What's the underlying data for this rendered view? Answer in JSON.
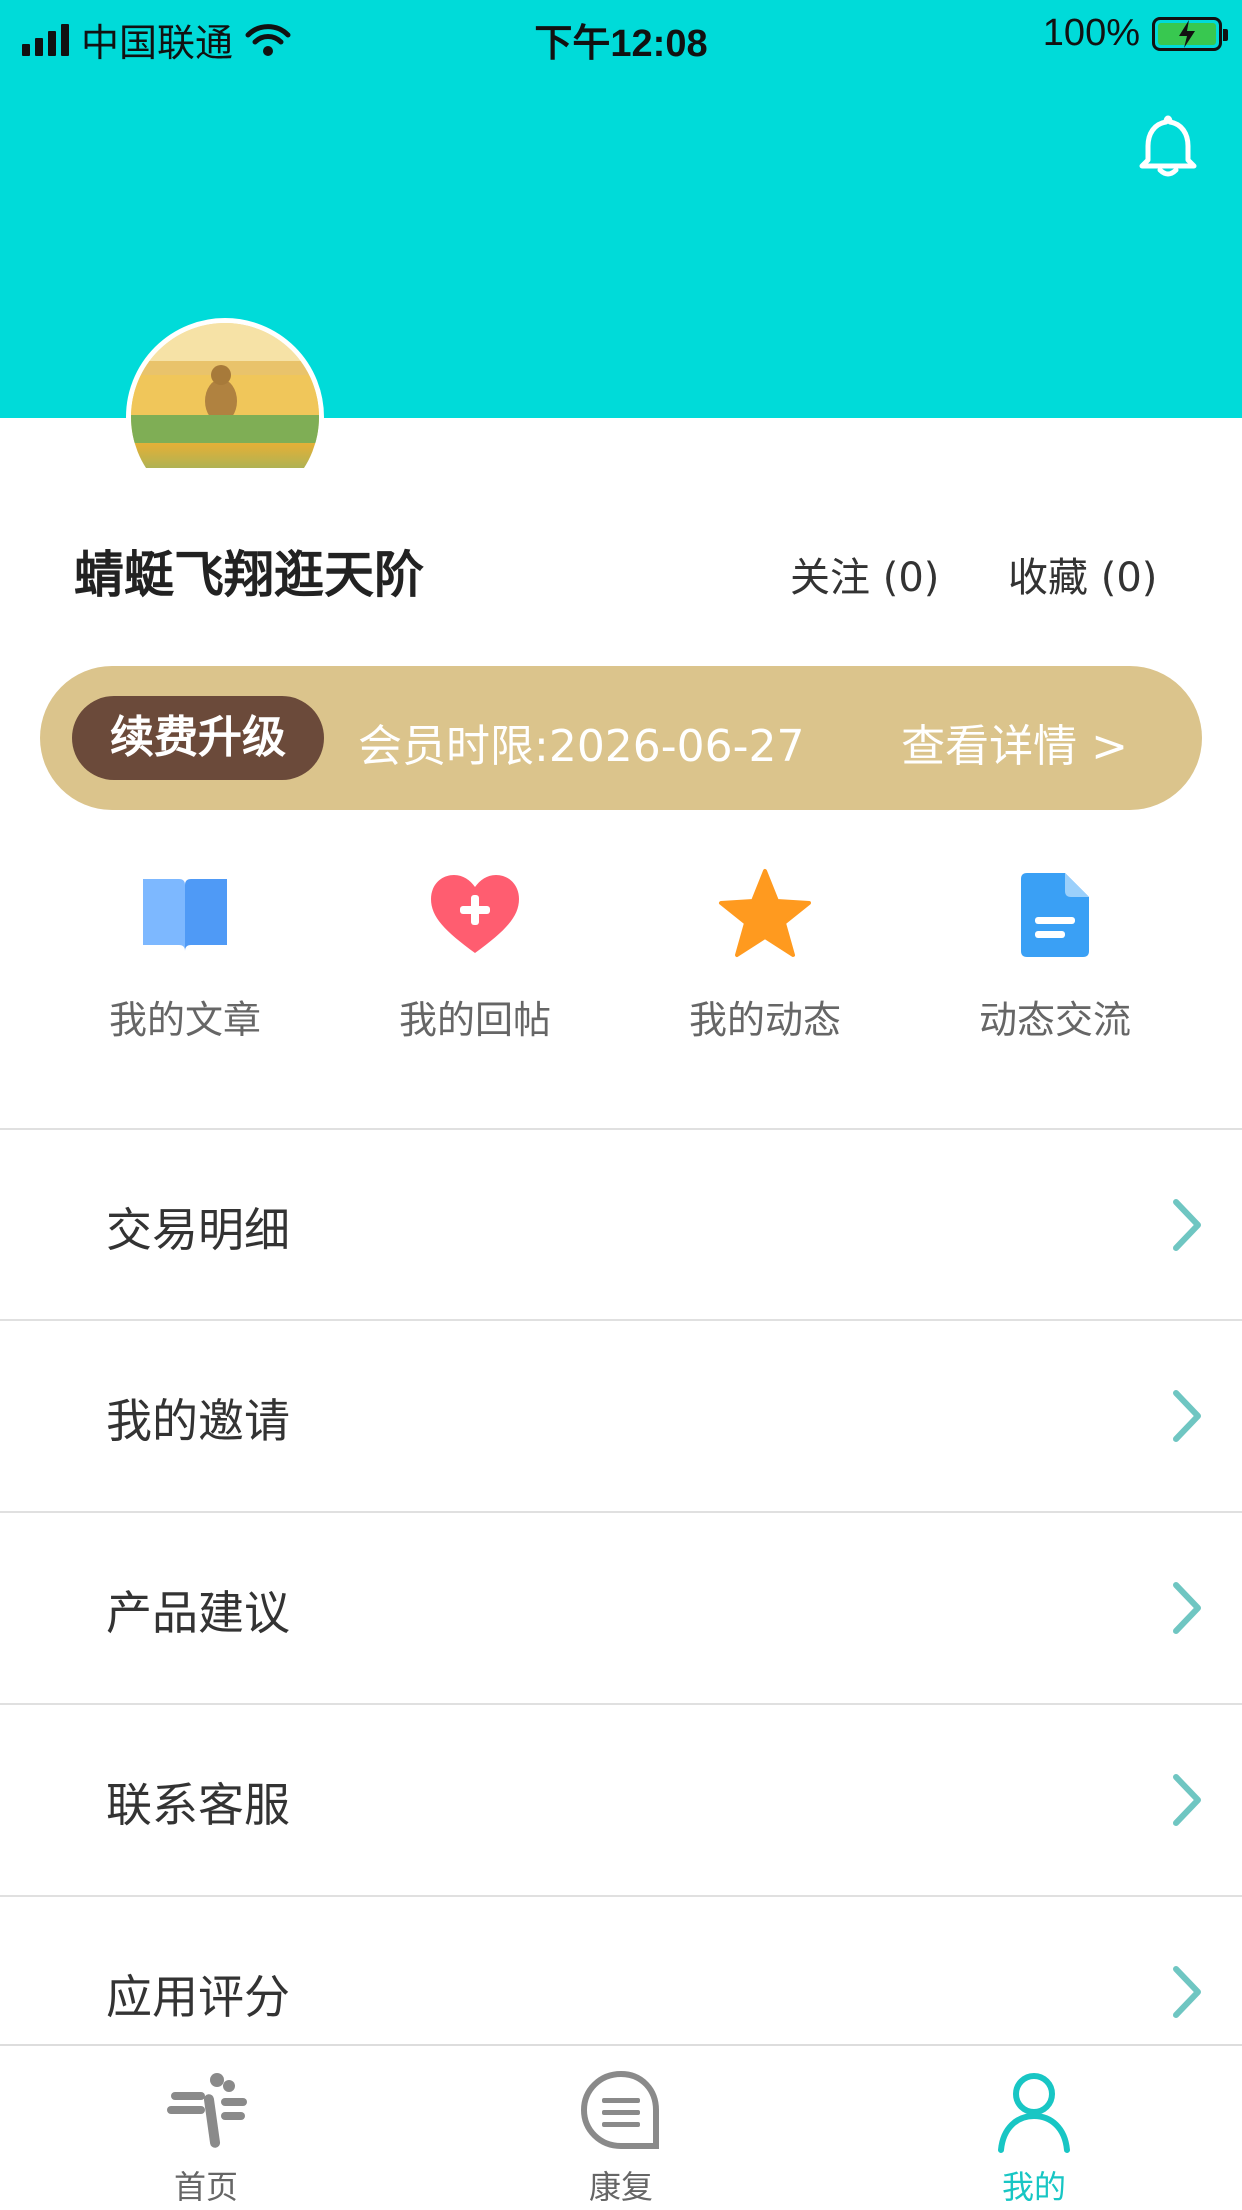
{
  "status_bar": {
    "carrier": "中国联通",
    "time": "下午12:08",
    "battery": "100%"
  },
  "profile": {
    "name": "蜻蜓飞翔逛天阶",
    "follow_label": "关注 (0)",
    "collect_label": "收藏 (0)"
  },
  "membership": {
    "renew_label": "续费升级",
    "expire_text": "会员时限:2026-06-27",
    "details_label": "查看详情 >"
  },
  "quick_actions": [
    {
      "label": "我的文章",
      "icon": "book-icon",
      "color": "#5aa6ff"
    },
    {
      "label": "我的回帖",
      "icon": "heart-plus-icon",
      "color": "#ff5a6e"
    },
    {
      "label": "我的动态",
      "icon": "star-icon",
      "color": "#ff9a1f"
    },
    {
      "label": "动态交流",
      "icon": "document-icon",
      "color": "#3aa0f5"
    }
  ],
  "menu": [
    {
      "label": "交易明细"
    },
    {
      "label": "我的邀请"
    },
    {
      "label": "产品建议"
    },
    {
      "label": "联系客服"
    },
    {
      "label": "应用评分"
    }
  ],
  "tabs": [
    {
      "label": "首页",
      "icon": "dragonfly-icon"
    },
    {
      "label": "康复",
      "icon": "chat-bubble-icon"
    },
    {
      "label": "我的",
      "icon": "person-icon"
    }
  ],
  "colors": {
    "header": "#00dbd9",
    "member_bar": "#dbc48c",
    "renew_button": "#6b4a3a",
    "active_tab": "#18c6c4"
  }
}
